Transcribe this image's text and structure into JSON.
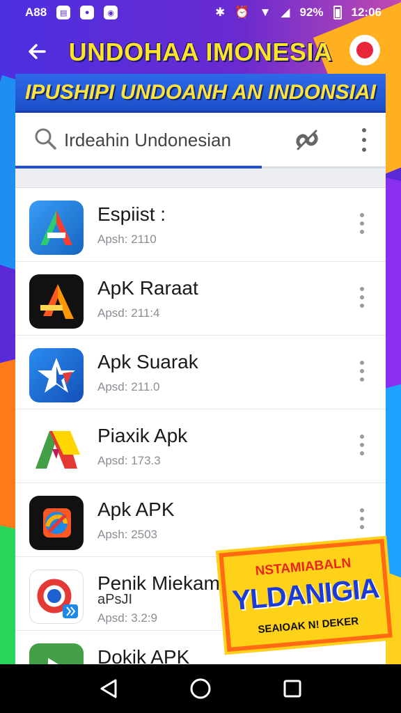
{
  "status_bar": {
    "left_text": "A88",
    "time": "12:06",
    "signal_text": "92%",
    "icons": [
      "message-icon",
      "circle-icon",
      "camera-icon",
      "bluetooth-icon",
      "alarm-icon",
      "wifi-icon",
      "signal-icon",
      "battery-icon"
    ]
  },
  "app_bar": {
    "title": "UNDOHAA IMONESIA",
    "back_icon": "back-arrow-icon",
    "chat_icon": "chat-bubble-icon"
  },
  "banner": {
    "text": "IPUSHIPI UNDOANH AN INDONSIAI"
  },
  "search": {
    "value": "Irdeahin Undonesian",
    "icons": [
      "search-icon",
      "link-icon",
      "more-vert-icon"
    ]
  },
  "apps": [
    {
      "name": "Espiist :",
      "sub": "Apsh: 2110",
      "icon": "letter-a-icon",
      "colors": [
        "#1e88e5",
        "#2ecc71",
        "#ff3b30"
      ]
    },
    {
      "name": "ApK Raraat",
      "sub": "Apsd: 211:4",
      "icon": "letter-a-icon",
      "colors": [
        "#111111",
        "#ff9800",
        "#ffd54f"
      ]
    },
    {
      "name": "Apk Suarak",
      "sub": "Apsd: 211.0",
      "icon": "star-icon",
      "colors": [
        "#1e88e5",
        "#ffffff",
        "#e53935"
      ]
    },
    {
      "name": "Piaxik Apk",
      "sub": "Apsd: 173.3",
      "icon": "flag-icon",
      "colors": [
        "#ffffff",
        "#ffd600",
        "#e53935"
      ]
    },
    {
      "name": "Apk  APK",
      "sub": "Apsh: 2503",
      "icon": "swirl-icon",
      "colors": [
        "#111111",
        "#ff5722",
        "#1e88e5"
      ]
    },
    {
      "name": "Penik Miekamn",
      "sub2": "aPsJI",
      "sub": "Apsd: 3.2:9",
      "icon": "ring-icon",
      "colors": [
        "#ffffff",
        "#e53935",
        "#1e88e5"
      ]
    },
    {
      "name": "Dokik APK",
      "sub": "",
      "icon": "play-icon",
      "colors": [
        "#43a047",
        "#ffffff",
        "#1e88e5"
      ]
    }
  ],
  "promo": {
    "top": "NSTAMIABALN",
    "main": "YLDANIGIA",
    "bottom": "SEAIOAK N! DEKER"
  },
  "nav": {
    "icons": [
      "back-triangle-icon",
      "home-circle-icon",
      "recents-square-icon"
    ]
  }
}
